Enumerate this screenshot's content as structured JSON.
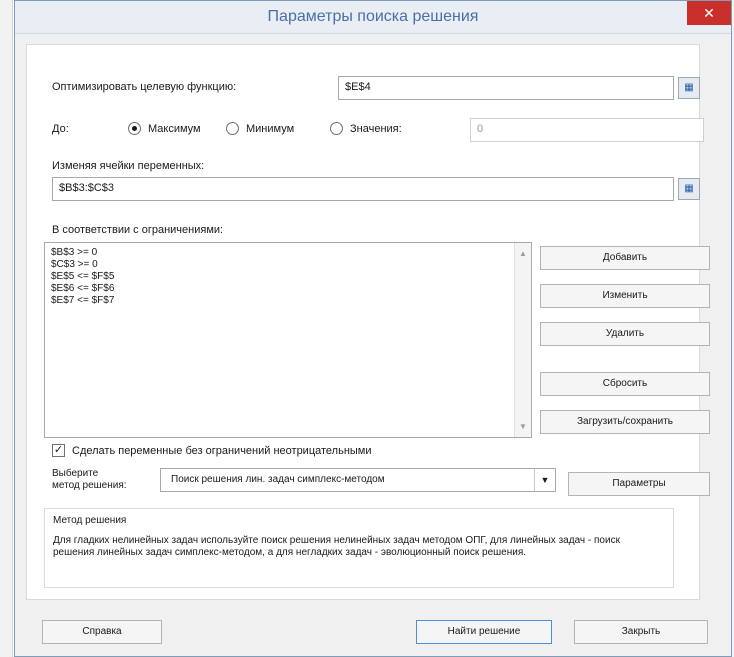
{
  "dialog": {
    "title": "Параметры поиска решения",
    "close_label": "✕"
  },
  "objective": {
    "label": "Оптимизировать целевую функцию:",
    "value": "$E$4"
  },
  "to": {
    "label": "До:",
    "options": [
      "Максимум",
      "Минимум",
      "Значения:"
    ],
    "selected": "Максимум",
    "value_field": "0"
  },
  "variables": {
    "label": "Изменяя ячейки переменных:",
    "value": "$B$3:$C$3"
  },
  "constraints": {
    "label": "В соответствии с ограничениями:",
    "items": [
      "$B$3 >= 0",
      "$C$3 >= 0",
      "$E$5 <= $F$5",
      "$E$6 <= $F$6",
      "$E$7 <= $F$7"
    ]
  },
  "buttons": {
    "add": "Добавить",
    "change": "Изменить",
    "delete": "Удалить",
    "reset": "Сбросить",
    "load_save": "Загрузить/сохранить",
    "params": "Параметры",
    "help": "Справка",
    "solve": "Найти решение",
    "close": "Закрыть"
  },
  "nonneg": {
    "label": "Сделать переменные без ограничений неотрицательными",
    "checked": true
  },
  "method": {
    "label_line1": "Выберите",
    "label_line2": "метод решения:",
    "value": "Поиск решения лин. задач симплекс-методом"
  },
  "method_info": {
    "title": "Метод решения",
    "description": "Для гладких нелинейных задач используйте поиск решения нелинейных задач методом ОПГ, для линейных задач - поиск решения линейных задач симплекс-методом, а для негладких задач - эволюционный поиск решения."
  },
  "colors": {
    "title_text": "#4a6fa5",
    "close_bg": "#c9302c",
    "panel_bg": "#ffffff",
    "dialog_bg": "#f0f0f0"
  },
  "icons": {
    "ref_button": "cell-reference-icon",
    "dropdown": "chevron-down-icon"
  }
}
